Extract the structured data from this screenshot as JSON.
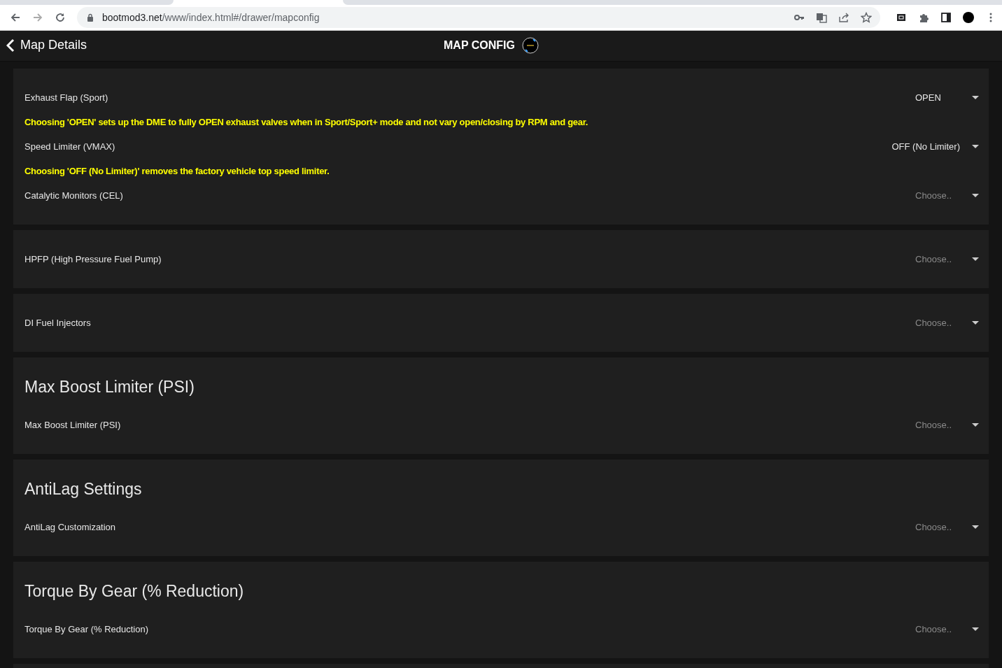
{
  "browser": {
    "url_host": "bootmod3.net",
    "url_path": "/www/index.html#/drawer/mapconfig"
  },
  "header": {
    "back_label": "Map Details",
    "title": "MAP CONFIG"
  },
  "cards": [
    {
      "kind": "section",
      "rows": [
        {
          "kind": "select",
          "label": "Exhaust Flap (Sport)",
          "value": "OPEN"
        },
        {
          "kind": "note",
          "text": "Choosing 'OPEN' sets up the DME to fully OPEN exhaust valves when in Sport/Sport+ mode and not vary open/closing by RPM and gear."
        },
        {
          "kind": "select",
          "label": "Speed Limiter (VMAX)",
          "value": "OFF (No Limiter)"
        },
        {
          "kind": "note",
          "text": "Choosing 'OFF (No Limiter)' removes the factory vehicle top speed limiter."
        },
        {
          "kind": "select",
          "label": "Catalytic Monitors (CEL)",
          "placeholder": "Choose.."
        }
      ]
    },
    {
      "kind": "section",
      "rows": [
        {
          "kind": "select",
          "label": "HPFP (High Pressure Fuel Pump)",
          "placeholder": "Choose.."
        }
      ]
    },
    {
      "kind": "section",
      "rows": [
        {
          "kind": "select",
          "label": "DI Fuel Injectors",
          "placeholder": "Choose.."
        }
      ]
    },
    {
      "kind": "section",
      "heading": "Max Boost Limiter (PSI)",
      "rows": [
        {
          "kind": "select",
          "label": "Max Boost Limiter (PSI)",
          "placeholder": "Choose.."
        }
      ]
    },
    {
      "kind": "section",
      "heading": "AntiLag Settings",
      "rows": [
        {
          "kind": "select",
          "label": "AntiLag Customization",
          "placeholder": "Choose.."
        }
      ]
    },
    {
      "kind": "section",
      "heading": "Torque By Gear (% Reduction)",
      "rows": [
        {
          "kind": "select",
          "label": "Torque By Gear (% Reduction)",
          "placeholder": "Choose.."
        }
      ]
    },
    {
      "kind": "section"
    }
  ]
}
